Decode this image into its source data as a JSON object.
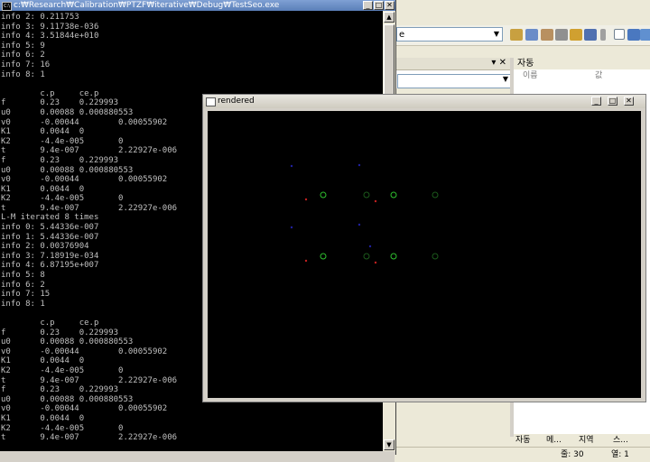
{
  "ide": {
    "combo_text": "e",
    "right_panel_title": "자동",
    "col_name": "이름",
    "col_value": "값",
    "bottom_tabs": [
      "자동",
      "메...",
      "지역",
      "스..."
    ],
    "status_line_label": "줄: 30",
    "status_col_label": "열: 1",
    "panel_close_glyph": "▾ ✕"
  },
  "console": {
    "title": "c:₩Research₩Calibration₩PTZF₩iterative₩Debug₩TestSeo.exe",
    "icon_text": "C:\\",
    "lines": [
      "info 2: 0.211753",
      "info 3: 9.11738e-036",
      "info 4: 3.51844e+010",
      "info 5: 9",
      "info 6: 2",
      "info 7: 16",
      "info 8: 1",
      "",
      "        c.p     ce.p",
      "f       0.23    0.229993",
      "u0      0.00088 0.000880553",
      "v0      -0.00044        0.00055902",
      "K1      0.0044  0",
      "K2      -4.4e-005       0",
      "t       9.4e-007        2.22927e-006",
      "f       0.23    0.229993",
      "u0      0.00088 0.000880553",
      "v0      -0.00044        0.00055902",
      "K1      0.0044  0",
      "K2      -4.4e-005       0",
      "t       9.4e-007        2.22927e-006",
      "L-M iterated 8 times",
      "info 0: 5.44336e-007",
      "info 1: 5.44336e-007",
      "info 2: 0.00376904",
      "info 3: 7.18919e-034",
      "info 4: 6.87195e+007",
      "info 5: 8",
      "info 6: 2",
      "info 7: 15",
      "info 8: 1",
      "",
      "        c.p     ce.p",
      "f       0.23    0.229993",
      "u0      0.00088 0.000880553",
      "v0      -0.00044        0.00055902",
      "K1      0.0044  0",
      "K2      -4.4e-005       0",
      "t       9.4e-007        2.22927e-006",
      "f       0.23    0.229993",
      "u0      0.00088 0.000880553",
      "v0      -0.00044        0.00055902",
      "K1      0.0044  0",
      "K2      -4.4e-005       0",
      "t       9.4e-007        2.22927e-006"
    ]
  },
  "rendered": {
    "title": "rendered"
  },
  "window_buttons": {
    "minimize": "_",
    "maximize": "□",
    "close": "✕"
  },
  "colors": {
    "console_bg": "#000000",
    "console_text": "#c0c0c0",
    "marker_green": "#2ec02e",
    "marker_dark_green": "#1c5a1c",
    "marker_red": "#c02020",
    "marker_blue": "#2020a0"
  }
}
